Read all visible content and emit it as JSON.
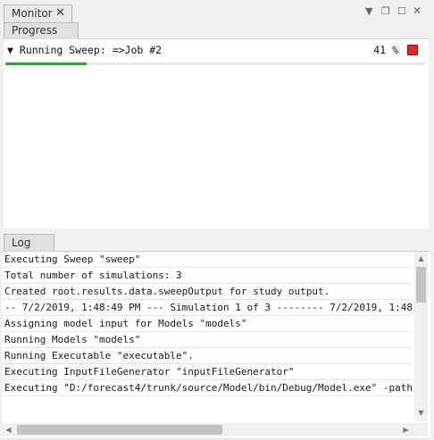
{
  "tabs": {
    "monitor": "Monitor",
    "progress": "Progress",
    "log": "Log"
  },
  "window_controls": [
    "chevron-down-icon",
    "restore-icon",
    "maximize-icon",
    "close-icon"
  ],
  "job": {
    "label": "▼ Running Sweep: =>Job #2",
    "percent_text": "41 %",
    "progress": 0.41
  },
  "colors": {
    "progress_fill": "#3c9e3c",
    "stop_button": "#e02a2a"
  },
  "log": {
    "lines": [
      "Executing Sweep \"sweep\"",
      "Total number of simulations: 3",
      "Created root.results.data.sweepOutput for study output.",
      "-- 7/2/2019, 1:48:49 PM --- Simulation 1 of 3 -------- 7/2/2019, 1:48",
      "Assigning model input for Models \"models\"",
      "Running Models \"models\"",
      "Running Executable \"executable\".",
      "Executing InputFileGenerator \"inputFileGenerator\"",
      "Executing \"D:/forecast4/trunk/source/Model/bin/Debug/Model.exe\" -path"
    ]
  }
}
